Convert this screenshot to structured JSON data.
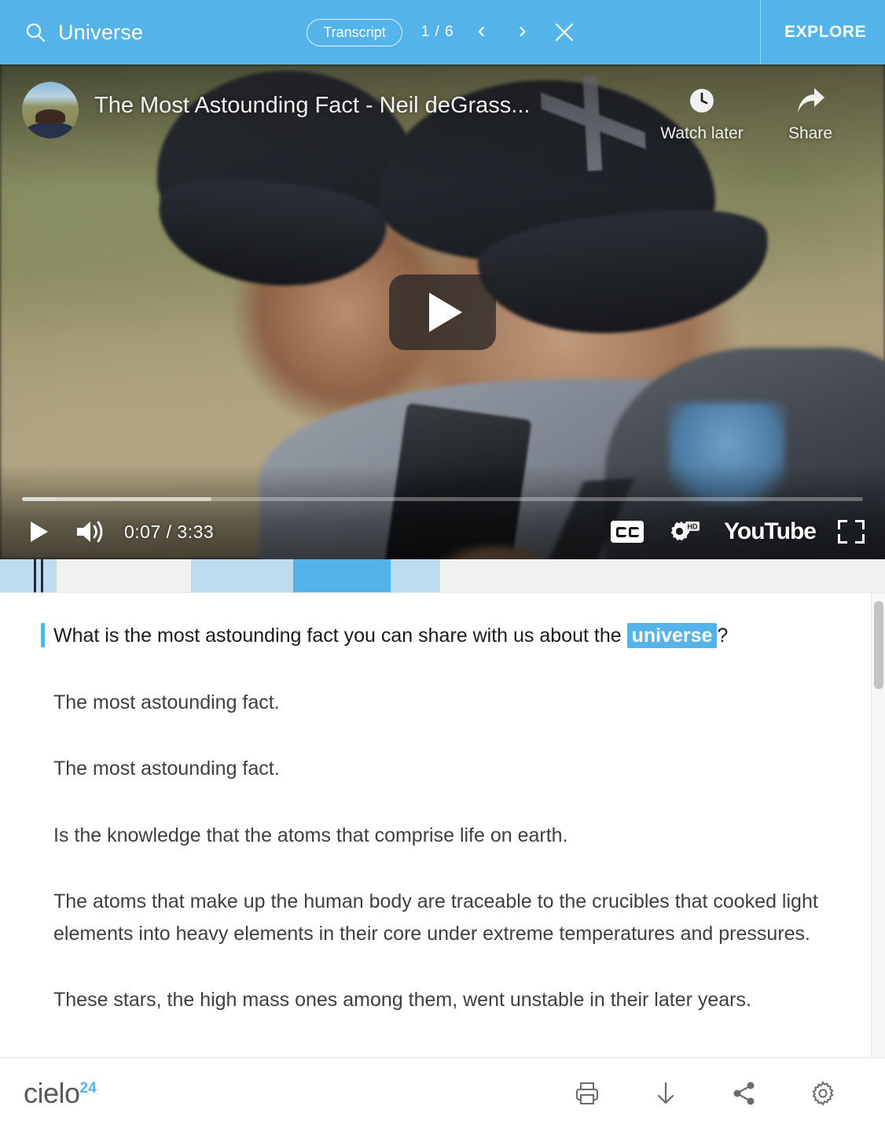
{
  "header": {
    "search_icon": "search-icon",
    "search_value": "Universe",
    "transcript_label": "Transcript",
    "page_counter": "1 / 6",
    "prev_icon": "chevron-left-icon",
    "next_icon": "chevron-right-icon",
    "close_icon": "close-icon",
    "explore_label": "EXPLORE",
    "accent_color": "#54b3e8"
  },
  "video": {
    "title": "The Most Astounding Fact - Neil deGrass...",
    "channel_avatar": "channel-avatar",
    "watch_later_label": "Watch later",
    "watch_later_icon": "clock-icon",
    "share_label": "Share",
    "share_icon": "share-arrow-icon",
    "play_overlay_icon": "play-button-icon",
    "controls": {
      "play_icon": "play-icon",
      "volume_icon": "volume-icon",
      "current_time": "0:07",
      "separator": "/",
      "duration": "3:33",
      "time_display": "0:07 / 3:33",
      "cc_icon": "closed-captions-icon",
      "settings_hd_icon": "settings-hd-icon",
      "hd_badge": "HD",
      "brand_label": "YouTube",
      "fullscreen_icon": "fullscreen-icon",
      "progress_played_percent": 4.2,
      "progress_loaded_percent": 22.5
    }
  },
  "timeline": {
    "playhead_percent": 4.6,
    "segments": [
      {
        "width_percent": 3.8,
        "color": "#bcdcf0"
      },
      {
        "width_percent": 0.3,
        "color": "#2b2b2b"
      },
      {
        "width_percent": 2.3,
        "color": "#bcdcf0"
      },
      {
        "width_percent": 15.2,
        "color": "#f1f1f1"
      },
      {
        "width_percent": 11.5,
        "color": "#bcdcf0"
      },
      {
        "width_percent": 11.0,
        "color": "#54b3e8"
      },
      {
        "width_percent": 5.6,
        "color": "#bcdcf0"
      },
      {
        "width_percent": 50.3,
        "color": "#f1f1f1"
      }
    ]
  },
  "transcript": {
    "paragraphs": [
      {
        "active": true,
        "pre": "What is the most astounding fact you can share with us about the ",
        "highlight": "universe",
        "post": "?"
      },
      {
        "active": false,
        "pre": "The most astounding fact.",
        "highlight": "",
        "post": ""
      },
      {
        "active": false,
        "pre": "The most astounding fact.",
        "highlight": "",
        "post": ""
      },
      {
        "active": false,
        "pre": "Is the knowledge that the atoms that comprise life on earth.",
        "highlight": "",
        "post": ""
      },
      {
        "active": false,
        "pre": "The atoms that make up the human body are traceable to the crucibles that cooked light elements into heavy elements in their core under extreme temperatures and pressures.",
        "highlight": "",
        "post": ""
      },
      {
        "active": false,
        "pre": "These stars, the high mass ones among them, went unstable in their later years.",
        "highlight": "",
        "post": ""
      }
    ],
    "highlight_color": "#54b3e8"
  },
  "footer": {
    "logo_text": "cielo",
    "logo_sup": "24",
    "logo_color": "#58595b",
    "logo_sup_color": "#54b3e8",
    "actions": [
      {
        "name": "print-icon",
        "label": "Print"
      },
      {
        "name": "download-icon",
        "label": "Download"
      },
      {
        "name": "share-icon",
        "label": "Share"
      },
      {
        "name": "settings-gear-icon",
        "label": "Settings"
      }
    ]
  }
}
